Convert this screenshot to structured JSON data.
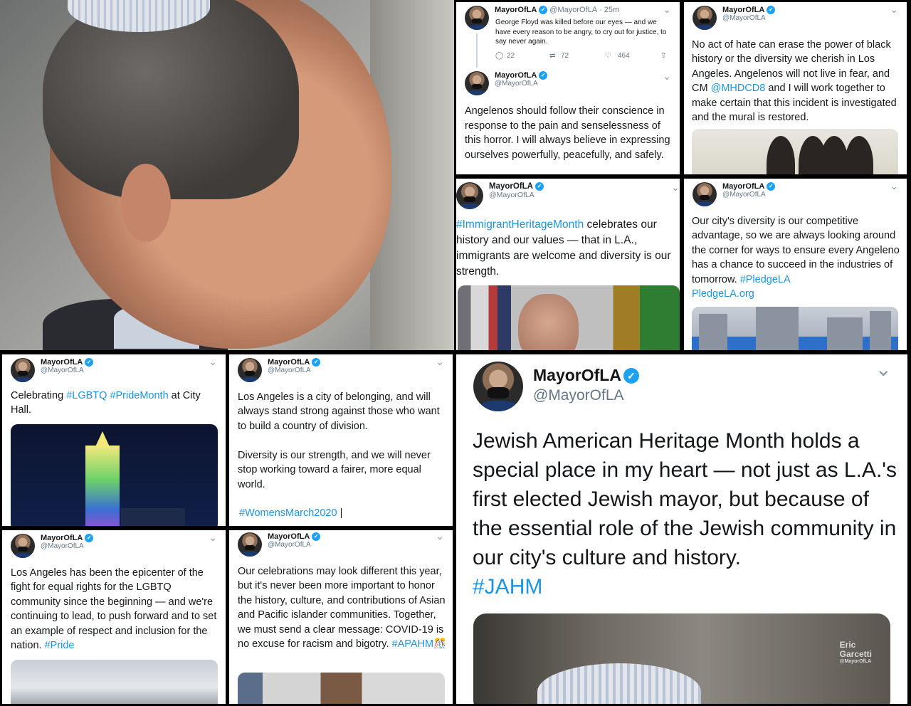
{
  "account": {
    "name": "MayorOfLA",
    "handle": "@MayorOfLA",
    "verified_color": "#1da1f2"
  },
  "link_color": "#1b95e0",
  "tweets": {
    "floyd": {
      "time": "· 25m",
      "text": "George Floyd was killed before our eyes — and we have every reason to be angry, to cry out for justice, to say never again.",
      "replies": "22",
      "retweets": "72",
      "likes": "464"
    },
    "conscience": {
      "text": "Angelenos should follow their conscience in response to the pain and senselessness of this horror. I will always believe in expressing ourselves powerfully, peacefully, and safely."
    },
    "hate": {
      "text_a": "No act of hate can erase the power of black history or the diversity we cherish in Los Angeles. Angelenos will not live in fear, and CM ",
      "mention": "@MHDCD8",
      "text_b": " and I will work together to make certain that this incident is investigated and the mural is restored."
    },
    "immigrant": {
      "hashtag": "#ImmigrantHeritageMonth",
      "text": " celebrates our history and our values — that in L.A., immigrants are welcome and diversity is our strength."
    },
    "diversity": {
      "text": "Our city's diversity is our competitive advantage, so we are always looking around the corner for ways to ensure every Angeleno has a chance to succeed in the industries of tomorrow. ",
      "hashtag": "#PledgeLA",
      "link": "PledgeLA.org"
    },
    "pride": {
      "text_a": "Celebrating ",
      "tag1": "#LGBTQ",
      "tag2": "#PrideMonth",
      "text_b": " at City Hall."
    },
    "belonging": {
      "text_1": "Los Angeles is a city of belonging, and will always stand strong against those who want to build a country of division.",
      "text_2": "Diversity is our strength, and we will never stop working toward a fairer, more equal world.",
      "hashtag": "#WomensMarch2020",
      "sep": " |"
    },
    "epicenter": {
      "text": "Los Angeles has been the epicenter of the fight for equal rights for the LGBTQ community since the beginning — and we're continuing to lead, to push forward and to set an example of respect and inclusion for the nation. ",
      "hashtag": "#Pride"
    },
    "apahm": {
      "text": "Our celebrations may look different this year, but it's never been more important to honor the history, culture, and contributions of Asian and Pacific islander communities. Together, we must send a clear message: COVID-19 is no excuse for racism and bigotry. ",
      "hashtag": "#APAHM",
      "emoji": "🎊"
    },
    "jahm": {
      "text": "Jewish American Heritage Month holds a special place in my heart — not just as L.A.'s first elected Jewish mayor, but because of the essential role of the Jewish community in our city's culture and history.",
      "hashtag": "#JAHM",
      "watermark_1": "Eric",
      "watermark_2": "Garcetti",
      "watermark_3": "@MayorOfLA"
    }
  },
  "icons": {
    "chevron": "⌄",
    "verified": "✓",
    "reply": "◯",
    "retweet": "⇄",
    "like": "♡",
    "share": "⇧"
  }
}
